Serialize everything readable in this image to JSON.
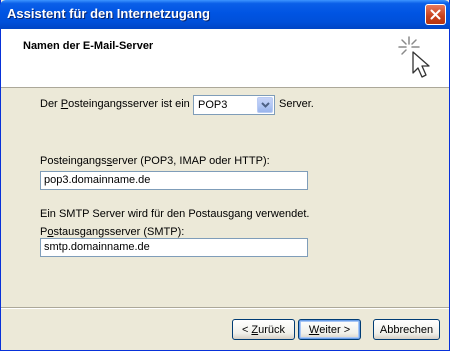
{
  "window": {
    "title": "Assistent für den Internetzugang",
    "close_icon": "close-icon"
  },
  "header": {
    "title": "Namen der E-Mail-Server",
    "icon": "wizard-sparkle-cursor-icon"
  },
  "server_type": {
    "label_before": "Der ",
    "label_mnemonic": "P",
    "label_after": "osteingangsserver ist ein",
    "selected": "POP3",
    "suffix": "Server."
  },
  "incoming": {
    "label_before": "Posteingangs",
    "label_mnemonic": "s",
    "label_after": "erver (POP3, IMAP oder HTTP):",
    "value": "pop3.domainname.de"
  },
  "smtp_note": "Ein SMTP Server wird für den Postausgang verwendet.",
  "outgoing": {
    "label_before": "P",
    "label_mnemonic": "o",
    "label_after": "stausgangsserver (SMTP):",
    "value": "smtp.domainname.de"
  },
  "buttons": {
    "back_prefix": "< ",
    "back_mnemonic": "Z",
    "back_rest": "urück",
    "next_mnemonic": "W",
    "next_rest": "eiter >",
    "cancel": "Abbrechen"
  }
}
